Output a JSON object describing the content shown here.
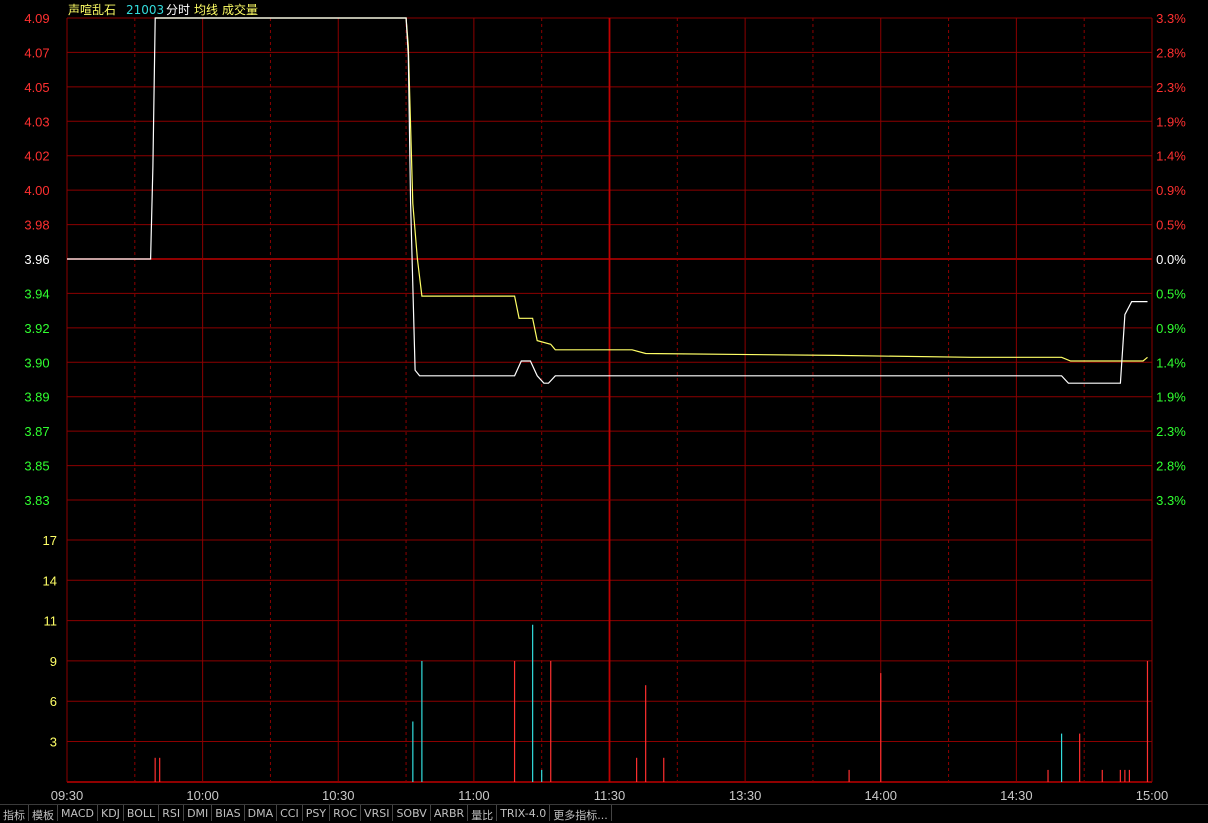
{
  "header": {
    "stock_name": "声喧乱石",
    "code": "21003",
    "labels": [
      "分时",
      "均线",
      "成交量"
    ]
  },
  "colors": {
    "grid": "#8c0000",
    "up": "#ff3030",
    "down": "#30ff30",
    "flat": "#ffffff",
    "price_line": "#ffffff",
    "avg_line": "#ffff66",
    "volume_up": "#ff3030",
    "volume_down": "#33dddd",
    "header_name": "#ffff66",
    "header_code": "#33dddd"
  },
  "chart_data": {
    "type": "line",
    "prev_close": 3.96,
    "price_ticks": [
      "4.09",
      "4.07",
      "4.05",
      "4.03",
      "4.02",
      "4.00",
      "3.98",
      "3.96",
      "3.94",
      "3.92",
      "3.90",
      "3.89",
      "3.87",
      "3.85",
      "3.83"
    ],
    "pct_ticks": [
      "3.3%",
      "2.8%",
      "2.3%",
      "1.9%",
      "1.4%",
      "0.9%",
      "0.5%",
      "0.0%",
      "0.5%",
      "0.9%",
      "1.4%",
      "1.9%",
      "2.3%",
      "2.8%",
      "3.3%"
    ],
    "volume_ticks": [
      "17",
      "14",
      "11",
      "9",
      "6",
      "3"
    ],
    "volume_max": 20,
    "time_ticks": [
      "09:30",
      "10:00",
      "10:30",
      "11:00",
      "11:30",
      "13:30",
      "14:00",
      "14:30",
      "15:00"
    ],
    "total_minutes": 240,
    "price_series": [
      [
        0,
        3.96
      ],
      [
        18.5,
        3.96
      ],
      [
        19,
        4.01
      ],
      [
        19.5,
        4.09
      ],
      [
        75,
        4.09
      ],
      [
        75.5,
        4.07
      ],
      [
        76,
        3.99
      ],
      [
        77,
        3.9
      ],
      [
        78,
        3.897
      ],
      [
        99,
        3.897
      ],
      [
        100.5,
        3.905
      ],
      [
        102.5,
        3.905
      ],
      [
        104,
        3.897
      ],
      [
        105.5,
        3.893
      ],
      [
        106.5,
        3.893
      ],
      [
        108,
        3.897
      ],
      [
        220,
        3.897
      ],
      [
        221.5,
        3.893
      ],
      [
        233,
        3.893
      ],
      [
        234,
        3.93
      ],
      [
        235.5,
        3.937
      ],
      [
        239,
        3.937
      ]
    ],
    "avg_series": [
      [
        19.5,
        4.09
      ],
      [
        75,
        4.09
      ],
      [
        75.5,
        4.075
      ],
      [
        76.5,
        3.99
      ],
      [
        77.5,
        3.96
      ],
      [
        78.5,
        3.94
      ],
      [
        99,
        3.94
      ],
      [
        100,
        3.928
      ],
      [
        103,
        3.928
      ],
      [
        104,
        3.916
      ],
      [
        107,
        3.914
      ],
      [
        108,
        3.911
      ],
      [
        125,
        3.911
      ],
      [
        128,
        3.909
      ],
      [
        170,
        3.908
      ],
      [
        200,
        3.907
      ],
      [
        220,
        3.907
      ],
      [
        222,
        3.905
      ],
      [
        238,
        3.905
      ],
      [
        239,
        3.907
      ]
    ],
    "volume_bars": [
      [
        19.5,
        2,
        "up"
      ],
      [
        20.5,
        2,
        "up"
      ],
      [
        76.5,
        5,
        "down"
      ],
      [
        78.5,
        10,
        "down"
      ],
      [
        99,
        10,
        "up"
      ],
      [
        103,
        13,
        "down"
      ],
      [
        105,
        1,
        "down"
      ],
      [
        107,
        10,
        "up"
      ],
      [
        126,
        2,
        "up"
      ],
      [
        128,
        8,
        "up"
      ],
      [
        132,
        2,
        "up"
      ],
      [
        173,
        1,
        "up"
      ],
      [
        180,
        9,
        "up"
      ],
      [
        217,
        1,
        "up"
      ],
      [
        220,
        4,
        "down"
      ],
      [
        224,
        4,
        "up"
      ],
      [
        229,
        1,
        "up"
      ],
      [
        233,
        1,
        "up"
      ],
      [
        234,
        1,
        "up"
      ],
      [
        235,
        1,
        "up"
      ],
      [
        239,
        10,
        "up"
      ]
    ]
  },
  "tabs": [
    "指标",
    "模板",
    "MACD",
    "KDJ",
    "BOLL",
    "RSI",
    "DMI",
    "BIAS",
    "DMA",
    "CCI",
    "PSY",
    "ROC",
    "VRSI",
    "SOBV",
    "ARBR",
    "量比",
    "TRIX-4.0",
    "更多指标..."
  ]
}
